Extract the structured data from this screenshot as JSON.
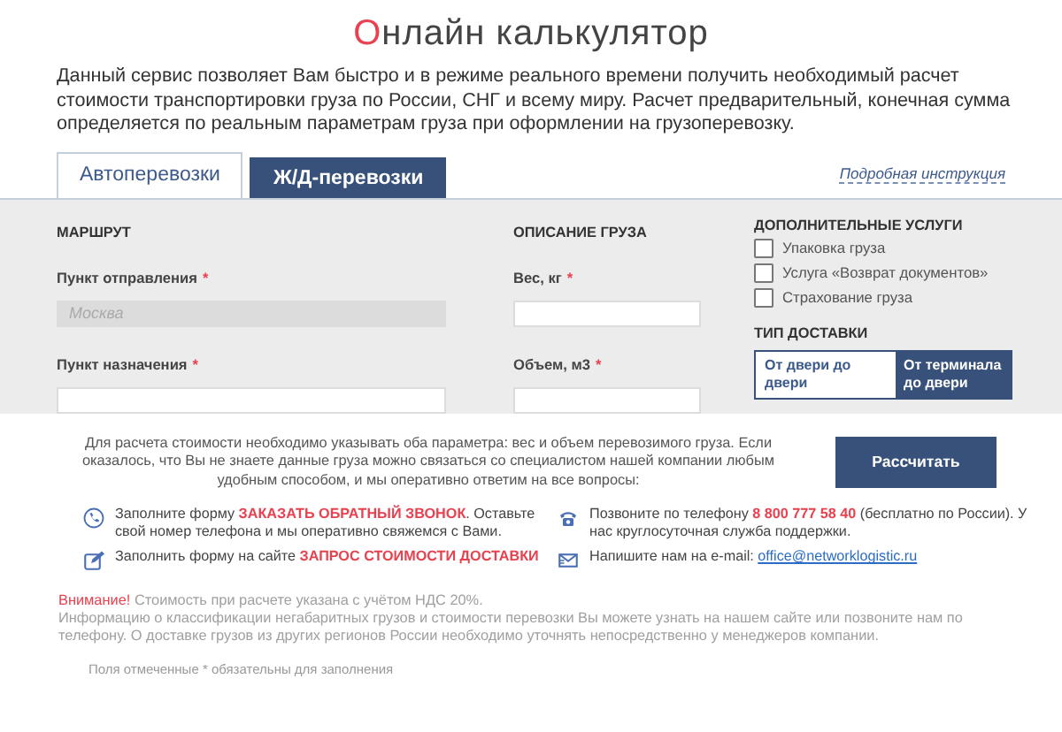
{
  "title": "Онлайн калькулятор",
  "intro": "Данный сервис позволяет Вам быстро и в режиме реального времени получить необходимый расчет стоимости транспортировки груза по России, СНГ и всему миру. Расчет предварительный, конечная сумма определяется по реальным параметрам груза при оформлении на грузоперевозку.",
  "tabs": [
    {
      "label": "Автоперевозки",
      "selected": true
    },
    {
      "label": "Ж/Д-перевозки",
      "selected": false
    }
  ],
  "instruction_link": "Подробная инструкция",
  "route": {
    "heading": "МАРШРУТ",
    "fields": [
      {
        "label": "Пункт отправления",
        "required_mark": "*",
        "placeholder": "Москва",
        "disabled": true
      },
      {
        "label": "Пункт назначения",
        "required_mark": "*",
        "disabled": false
      }
    ]
  },
  "cargo": {
    "heading": "ОПИСАНИЕ ГРУЗА",
    "fields": [
      {
        "label": "Вес, кг",
        "required_mark": "*",
        "disabled": false
      },
      {
        "label": "Объем, м3",
        "required_mark": "*",
        "disabled": false
      }
    ]
  },
  "services": {
    "heading": "ДОПОЛНИТЕЛЬНЫЕ УСЛУГИ",
    "options": [
      {
        "label": "Упаковка груза",
        "checked": false
      },
      {
        "label": "Услуга «Возврат документов»",
        "checked": false
      },
      {
        "label": "Страхование груза",
        "checked": false
      }
    ]
  },
  "delivery": {
    "heading": "ТИП ДОСТАВКИ",
    "options": [
      {
        "label": "От двери до двери",
        "selected": false
      },
      {
        "label": "От терминала до двери",
        "selected": true
      }
    ]
  },
  "hint": "Для расчета стоимости необходимо указывать оба параметра: вес и объем перевозимого груза. Если оказалось, что Вы не знаете данные груза можно связаться со специалистом нашей компании любым удобным способом, и мы оперативно ответим на все вопросы:",
  "calculate_button": "Рассчитать",
  "contacts": [
    {
      "kind": "callback",
      "text": "Заполните форму ",
      "link": "ЗАКАЗАТЬ ОБРАТНЫЙ ЗВОНОК",
      "text_after": ". Оставьте свой номер телефона и мы оперативно свяжемся с Вами."
    },
    {
      "kind": "phone",
      "text": "Позвоните по телефону **8 800 777 58 40** (бесплатно по России). У нас круглосуточная служба поддержки."
    },
    {
      "kind": "form",
      "text": "Заполнить форму на сайте ",
      "link": "ЗАПРОС СТОИМОСТИ ДОСТАВКИ"
    },
    {
      "kind": "email",
      "text": "Напишите нам на e-mail: ",
      "link": "office@networklogistic.ru"
    }
  ],
  "notes": [
    "**Внимание!** Стоимость при расчете указана с учётом НДС 20%.",
    "Информацию о классификации негабаритных грузов и стоимости перевозки Вы можете узнать на нашем сайте или позвоните нам по телефону. О доставке грузов из других регионов России необходимо уточнять непосредственно у менеджеров компании."
  ],
  "footnote": "Поля отмеченные * обязательны для заполнения"
}
